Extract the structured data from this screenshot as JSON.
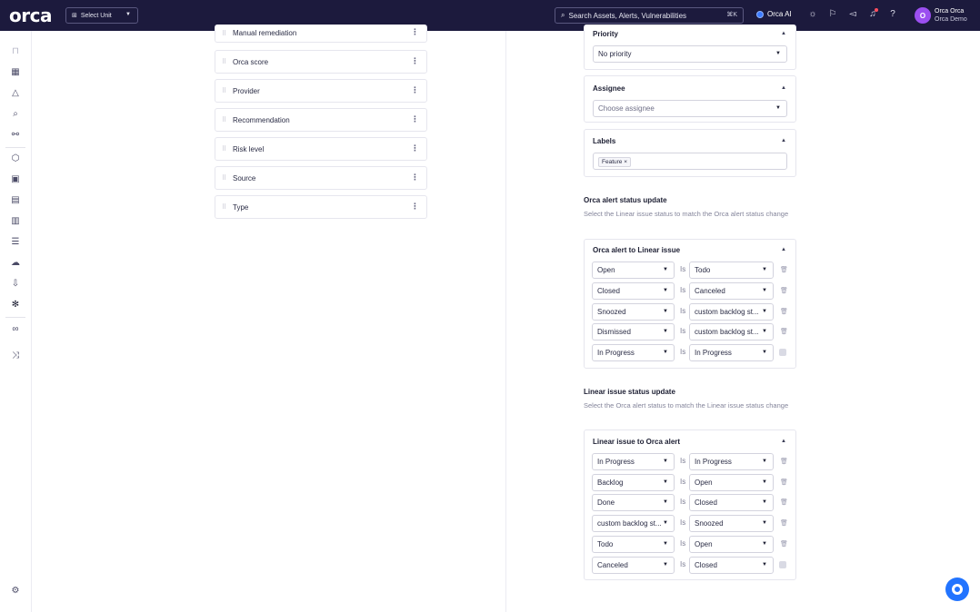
{
  "topbar": {
    "logo": "orca",
    "unit_select": "Select Unit",
    "search_placeholder": "Search Assets, Alerts, Vulnerabilities",
    "search_shortcut": "⌘K",
    "orca_ai": "Orca AI",
    "avatar_initial": "O",
    "user_name": "Orca Orca",
    "user_org": "Orca Demo"
  },
  "fields": [
    "Manual remediation",
    "Orca score",
    "Provider",
    "Recommendation",
    "Risk level",
    "Source",
    "Type"
  ],
  "priority": {
    "title": "Priority",
    "value": "No priority"
  },
  "assignee": {
    "title": "Assignee",
    "placeholder": "Choose assignee"
  },
  "labels": {
    "title": "Labels",
    "chip": "Feature ×"
  },
  "alert_status": {
    "title": "Orca alert status update",
    "description": "Select the Linear issue status to match the Orca alert status change",
    "card_title": "Orca alert to Linear issue",
    "rows": [
      {
        "from": "Open",
        "to": "Todo"
      },
      {
        "from": "Closed",
        "to": "Canceled"
      },
      {
        "from": "Snoozed",
        "to": "custom backlog st..."
      },
      {
        "from": "Dismissed",
        "to": "custom backlog st..."
      },
      {
        "from": "In Progress",
        "to": "In Progress"
      }
    ]
  },
  "issue_status": {
    "title": "Linear issue status update",
    "description": "Select the Orca alert status to match the Linear issue status change",
    "card_title": "Linear issue to Orca alert",
    "rows": [
      {
        "from": "In Progress",
        "to": "In Progress"
      },
      {
        "from": "Backlog",
        "to": "Open"
      },
      {
        "from": "Done",
        "to": "Closed"
      },
      {
        "from": "custom backlog st...",
        "to": "Snoozed"
      },
      {
        "from": "Todo",
        "to": "Open"
      },
      {
        "from": "Canceled",
        "to": "Closed"
      }
    ]
  },
  "is_label": "Is"
}
